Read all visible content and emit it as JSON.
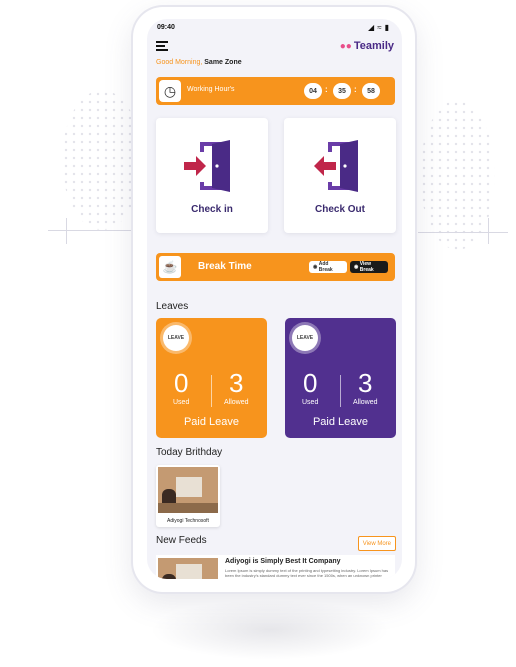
{
  "status": {
    "time": "09:40",
    "icons": [
      "signal-icon",
      "wifi-icon",
      "battery-icon"
    ]
  },
  "header": {
    "logo_text": "Teamily",
    "greeting_prefix": "Good Morning,",
    "greeting_name": "Same Zone"
  },
  "working_hours": {
    "label": "Working Hour's",
    "hours": "04",
    "minutes": "35",
    "seconds": "58"
  },
  "attendance": {
    "check_in_label": "Check in",
    "check_out_label": "Check Out"
  },
  "break": {
    "label": "Break Time",
    "add_label": "Add Break",
    "view_label": "View Break"
  },
  "leaves": {
    "section_title": "Leaves",
    "cards": [
      {
        "used": "0",
        "used_label": "Used",
        "allowed": "3",
        "allowed_label": "Allowed",
        "title": "Paid Leave",
        "badge": "LEAVE"
      },
      {
        "used": "0",
        "used_label": "Used",
        "allowed": "3",
        "allowed_label": "Allowed",
        "title": "Paid Leave",
        "badge": "LEAVE"
      }
    ]
  },
  "birthday": {
    "section_title": "Today Brithday",
    "name": "Adiyogi Technosoft"
  },
  "feeds": {
    "section_title": "New Feeds",
    "view_more": "View More",
    "item": {
      "title": "Adiyogi is Simply Best It Company",
      "text": "Lorem Ipsum is simply dummy text of the printing and typesetting industry. Lorem Ipsum has been the industry's standard dummy text ever since the 1500s, when an unknown printer took a galley of"
    }
  },
  "colors": {
    "orange": "#f7941d",
    "purple": "#51308f",
    "check_arrow": "#c0264a"
  }
}
